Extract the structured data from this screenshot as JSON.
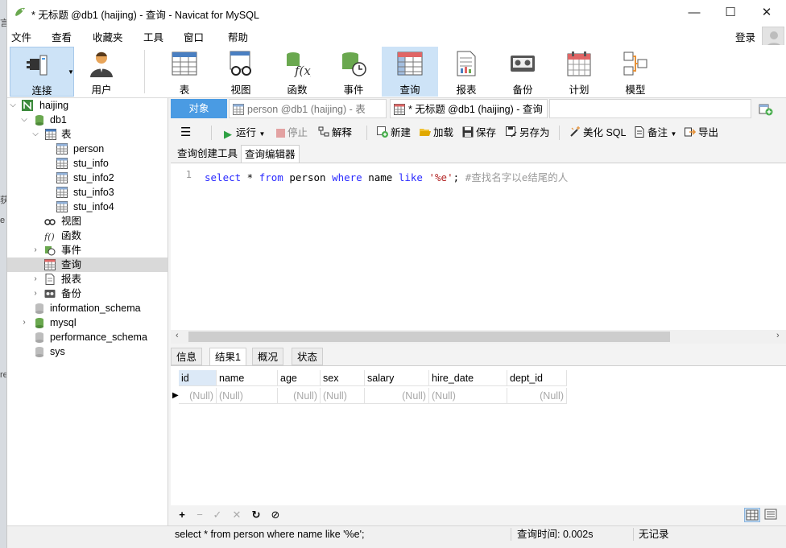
{
  "window": {
    "title": "* 无标题 @db1 (haijing) - 查询 - Navicat for MySQL",
    "minimize": "—",
    "maximize": "☐",
    "close": "✕"
  },
  "menu": {
    "items": [
      "文件",
      "查看",
      "收藏夹",
      "工具",
      "窗口",
      "帮助"
    ],
    "login": "登录"
  },
  "toolbar": {
    "buttons": [
      {
        "label": "连接",
        "icon": "plug-icon"
      },
      {
        "label": "用户",
        "icon": "user-icon"
      },
      {
        "label": "表",
        "icon": "table-icon"
      },
      {
        "label": "视图",
        "icon": "view-icon"
      },
      {
        "label": "函数",
        "icon": "function-icon"
      },
      {
        "label": "事件",
        "icon": "event-icon"
      },
      {
        "label": "查询",
        "icon": "query-icon"
      },
      {
        "label": "报表",
        "icon": "report-icon"
      },
      {
        "label": "备份",
        "icon": "backup-icon"
      },
      {
        "label": "计划",
        "icon": "calendar-icon"
      },
      {
        "label": "模型",
        "icon": "model-icon"
      }
    ]
  },
  "tree": {
    "connection": "haijing",
    "database": "db1",
    "tables_label": "表",
    "tables": [
      "person",
      "stu_info",
      "stu_info2",
      "stu_info3",
      "stu_info4"
    ],
    "views_label": "视图",
    "functions_label": "函数",
    "events_label": "事件",
    "queries_label": "查询",
    "reports_label": "报表",
    "backups_label": "备份",
    "other_dbs": [
      "information_schema",
      "mysql",
      "performance_schema",
      "sys"
    ]
  },
  "tabs": {
    "objects": "对象",
    "person_tab": "person @db1 (haijing) - 表",
    "query_tab": "* 无标题 @db1 (haijing) - 查询"
  },
  "query_toolbar": {
    "run": "运行",
    "stop": "停止",
    "explain": "解释",
    "new": "新建",
    "load": "加载",
    "save": "保存",
    "save_as": "另存为",
    "beautify": "美化 SQL",
    "comment": "备注",
    "export": "导出"
  },
  "editor_tabs": [
    "查询创建工具",
    "查询编辑器"
  ],
  "editor": {
    "line_number": "1",
    "tokens": {
      "select": "select",
      "star": " * ",
      "from": "from",
      "table": " person ",
      "where": "where",
      "column": " name ",
      "like": "like",
      "space": " ",
      "pattern": "'%e'",
      "semicolon": "; ",
      "comment": "#查找名字以e结尾的人"
    }
  },
  "result_tabs": [
    "信息",
    "结果1",
    "概况",
    "状态"
  ],
  "grid": {
    "columns": [
      "id",
      "name",
      "age",
      "sex",
      "salary",
      "hire_date",
      "dept_id"
    ],
    "row_marker": "▶",
    "rows": [
      [
        "(Null)",
        "(Null)",
        "(Null)",
        "(Null)",
        "(Null)",
        "(Null)",
        "(Null)"
      ]
    ]
  },
  "bottom_tools": [
    "+",
    "−",
    "✓",
    "✕",
    "↻",
    "⊘"
  ],
  "status": {
    "sql": "select * from person where name like '%e';",
    "query_time": "查询时间: 0.002s",
    "records": "无记录"
  },
  "colors": {
    "accent": "#4a9be3",
    "keyword": "#2a2aff",
    "string": "#b22222",
    "comment": "#9a9a9a"
  }
}
